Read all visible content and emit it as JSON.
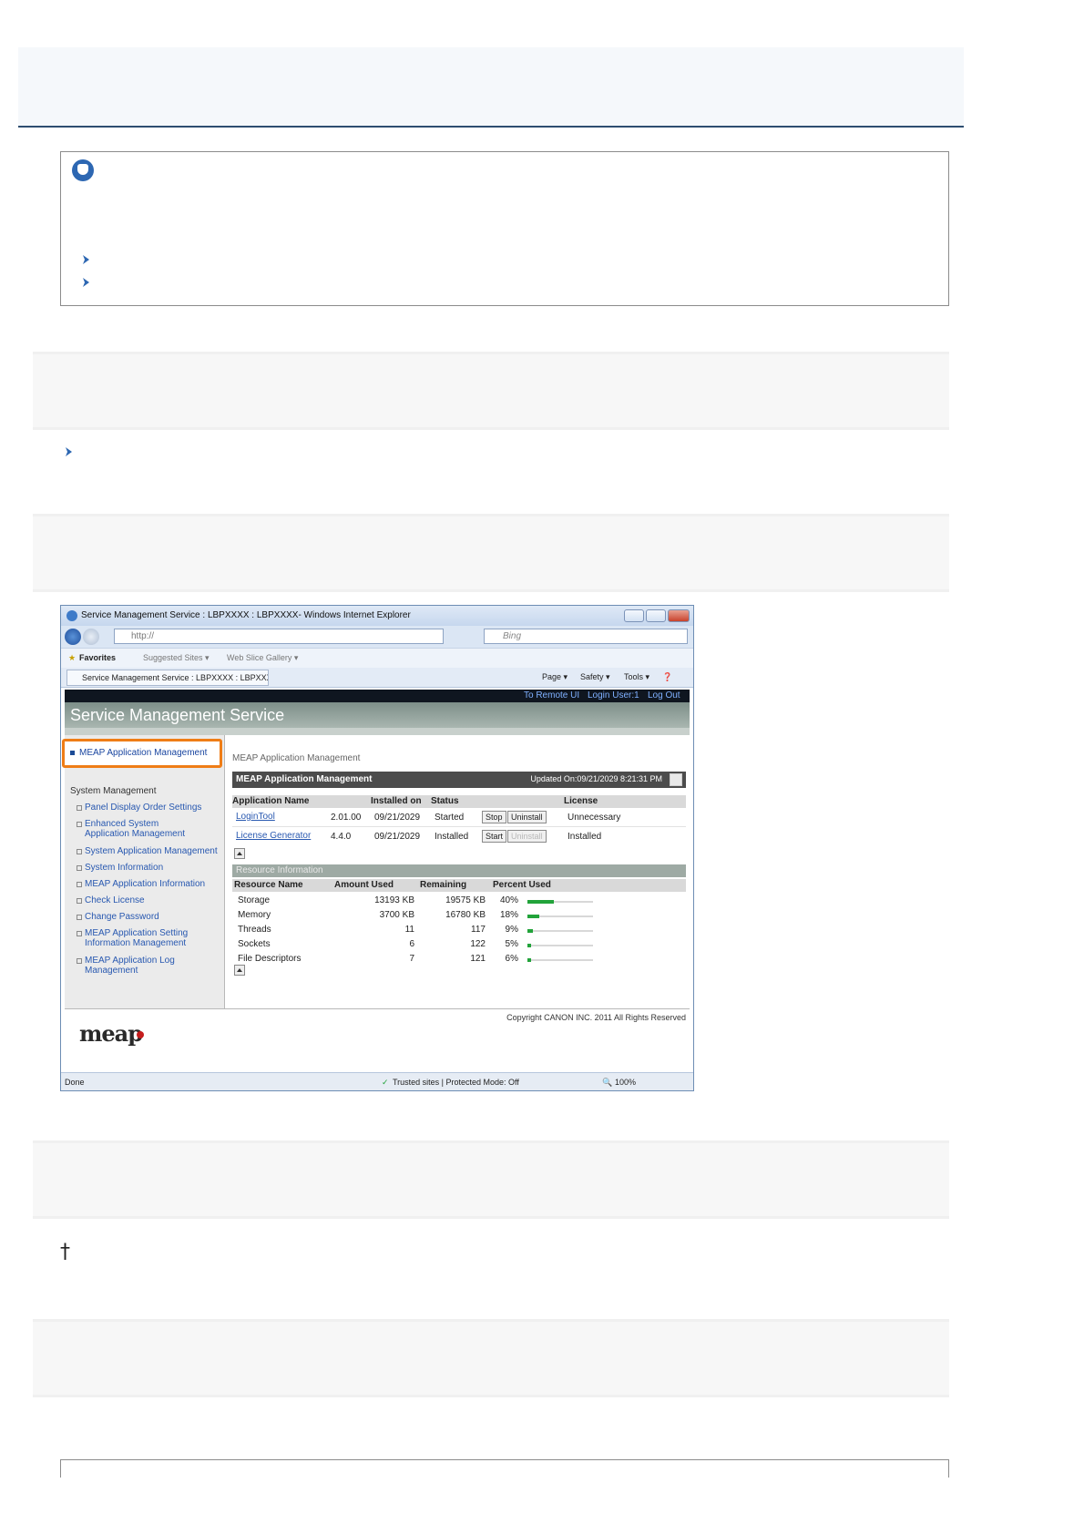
{
  "browser": {
    "window_title": "Service Management Service : LBPXXXX : LBPXXXX- Windows Internet Explorer",
    "address": "http://",
    "search_placeholder": "Bing",
    "favorites_label": "Favorites",
    "suggested_sites": "Suggested Sites ▾",
    "web_slice_gallery": "Web Slice Gallery ▾",
    "tab_title": "Service Management Service : LBPXXXX : LBPXXXX",
    "cmd_page": "Page ▾",
    "cmd_safety": "Safety ▾",
    "cmd_tools": "Tools ▾",
    "status_done": "Done",
    "status_zone": "Trusted sites | Protected Mode: Off",
    "zoom": "100%"
  },
  "sms": {
    "top_links": {
      "remote_ui": "To Remote UI",
      "login_user": "Login User:1",
      "logout": "Log Out"
    },
    "title": "Service Management Service",
    "sidebar": {
      "highlighted": "MEAP Application Management",
      "section_heading": "System Management",
      "items": [
        "Panel Display Order Settings",
        "Enhanced System Application Management",
        "System Application Management",
        "System Information",
        "MEAP Application Information",
        "Check License",
        "Change Password",
        "MEAP Application Setting Information Management",
        "MEAP Application Log Management"
      ]
    },
    "breadcrumb": "MEAP Application Management",
    "app_section": {
      "title": "MEAP Application Management",
      "updated": "Updated On:09/21/2029 8:21:31 PM",
      "headers": [
        "Application Name",
        "Installed on",
        "Status",
        "License"
      ],
      "rows": [
        {
          "name": "LoginTool",
          "version": "2.01.00",
          "installed": "09/21/2029",
          "status": "Started",
          "action": "Stop",
          "uninstall": "Uninstall",
          "license": "Unnecessary"
        },
        {
          "name": "License Generator",
          "version": "4.4.0",
          "installed": "09/21/2029",
          "status": "Installed",
          "action": "Start",
          "uninstall": "Uninstall",
          "license": "Installed"
        }
      ]
    },
    "resource_section": {
      "title": "Resource Information",
      "headers": [
        "Resource Name",
        "Amount Used",
        "Remaining",
        "Percent Used"
      ],
      "rows": [
        {
          "name": "Storage",
          "used": "13193 KB",
          "remaining": "19575 KB",
          "percent": "40%",
          "fraction": 0.4
        },
        {
          "name": "Memory",
          "used": "3700 KB",
          "remaining": "16780 KB",
          "percent": "18%",
          "fraction": 0.18
        },
        {
          "name": "Threads",
          "used": "11",
          "remaining": "117",
          "percent": "9%",
          "fraction": 0.09
        },
        {
          "name": "Sockets",
          "used": "6",
          "remaining": "122",
          "percent": "5%",
          "fraction": 0.05
        },
        {
          "name": "File Descriptors",
          "used": "7",
          "remaining": "121",
          "percent": "6%",
          "fraction": 0.06
        }
      ]
    },
    "copyright": "Copyright CANON INC. 2011 All Rights Reserved",
    "logo": "meap"
  },
  "page": {
    "dagger": "†"
  }
}
